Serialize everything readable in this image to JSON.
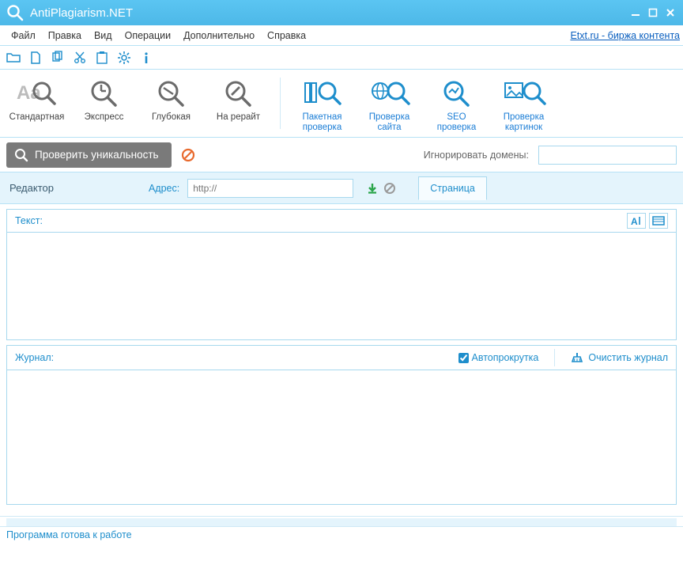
{
  "title": "AntiPlagiarism.NET",
  "menubar": {
    "items": [
      "Файл",
      "Правка",
      "Вид",
      "Операции",
      "Дополнительно",
      "Справка"
    ],
    "external_link": "Etxt.ru - биржа контента"
  },
  "ribbon": {
    "grey": [
      {
        "name": "standard",
        "label": "Стандартная"
      },
      {
        "name": "express",
        "label": "Экспресс"
      },
      {
        "name": "deep",
        "label": "Глубокая"
      },
      {
        "name": "rewrite",
        "label": "На рерайт"
      }
    ],
    "blue": [
      {
        "name": "batch",
        "label1": "Пакетная",
        "label2": "проверка"
      },
      {
        "name": "site",
        "label1": "Проверка",
        "label2": "сайта"
      },
      {
        "name": "seo",
        "label1": "SEO",
        "label2": "проверка"
      },
      {
        "name": "images",
        "label1": "Проверка",
        "label2": "картинок"
      }
    ]
  },
  "actionbar": {
    "check_label": "Проверить уникальность",
    "ignore_label": "Игнорировать домены:",
    "ignore_value": ""
  },
  "editor": {
    "label": "Редактор",
    "addr_label": "Адрес:",
    "addr_placeholder": "http://",
    "page_tab": "Страница"
  },
  "text_panel": {
    "label": "Текст:"
  },
  "journal": {
    "label": "Журнал:",
    "autoscroll_label": "Автопрокрутка",
    "autoscroll_checked": true,
    "clear_label": "Очистить журнал"
  },
  "status": "Программа готова к работе"
}
